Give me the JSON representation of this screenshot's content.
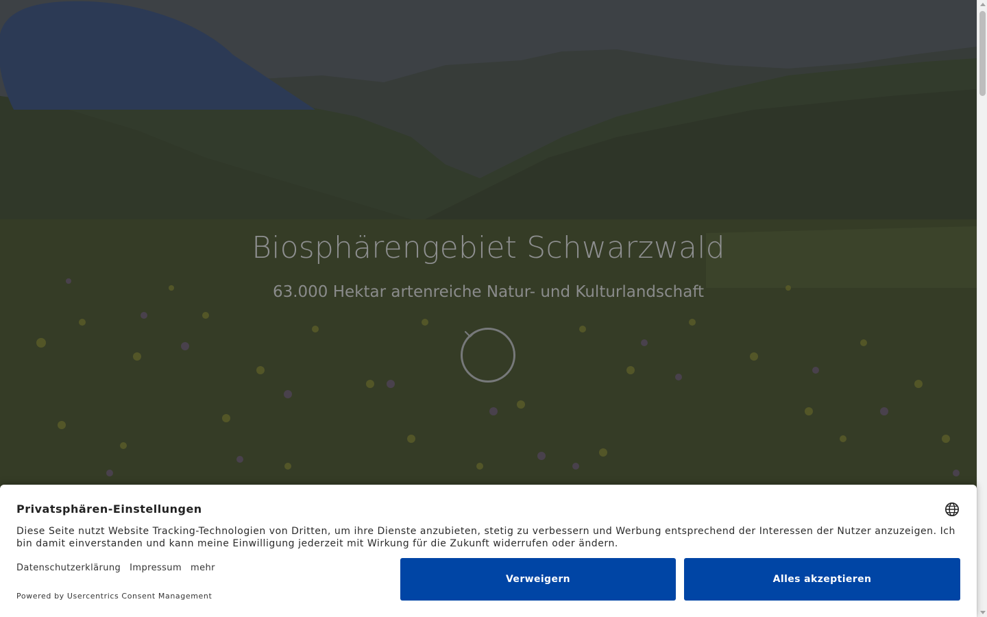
{
  "hero": {
    "title": "Biosphärengebiet Schwarzwald",
    "subtitle": "63.000 Hektar artenreiche Natur- und Kulturlandschaft",
    "scroll_icon": "chevron-down-icon"
  },
  "consent": {
    "title": "Privatsphären-Einstellungen",
    "language_icon": "globe-icon",
    "text": "Diese Seite nutzt Website Tracking-Technologien von Dritten, um ihre Dienste anzubieten, stetig zu verbessern und Werbung entsprechend der Interessen der Nutzer anzuzeigen. Ich bin damit einverstanden und kann meine Einwilligung jederzeit mit Wirkung für die Zukunft widerrufen oder ändern.",
    "links": {
      "privacy": "Datenschutzerklärung",
      "imprint": "Impressum",
      "more": "mehr"
    },
    "powered_by": "Powered by Usercentrics Consent Management",
    "deny_label": "Verweigern",
    "accept_label": "Alles akzeptieren"
  },
  "colors": {
    "button_blue": "#0045a5",
    "overlay_text": "#8e8f90"
  }
}
